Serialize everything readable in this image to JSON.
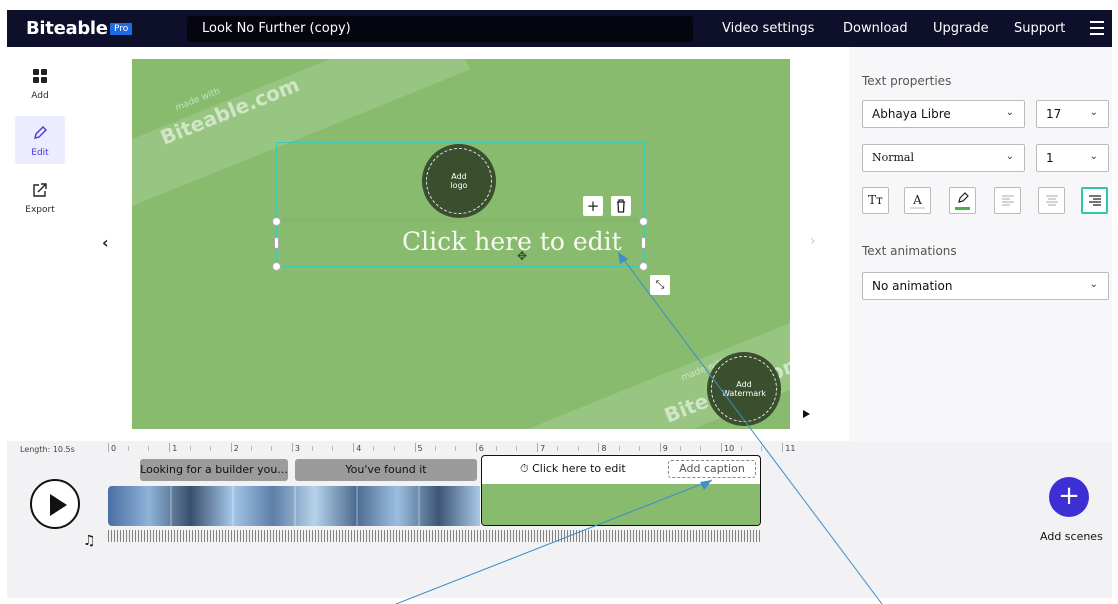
{
  "header": {
    "brand": "Biteable",
    "pro_badge": "Pro",
    "project_title": "Look No Further (copy)",
    "nav": [
      "Video settings",
      "Download",
      "Upgrade",
      "Support"
    ],
    "menu_icon": "hamburger-icon"
  },
  "rail": [
    {
      "label": "Add",
      "icon": "grid-icon"
    },
    {
      "label": "Edit",
      "icon": "pencil-icon",
      "active": true
    },
    {
      "label": "Export",
      "icon": "export-icon"
    }
  ],
  "canvas": {
    "background": "#88bb6e",
    "watermark_top_small": "made with",
    "watermark_top": "Biteable.com",
    "watermark_bottom_small": "made with",
    "watermark_bottom": "Biteable.com",
    "logo_badge": "Add\nlogo",
    "watermark_badge": "Add\nWatermark",
    "text": "Click here to edit",
    "prev_icon": "chevron-left-icon",
    "next_icon": "chevron-right-icon"
  },
  "panel": {
    "text_properties_title": "Text properties",
    "font_family": "Abhaya Libre",
    "font_size": "17",
    "font_style": "Normal",
    "line_height": "1",
    "format_icons": [
      "text-case-icon",
      "text-color-icon",
      "highlight-icon",
      "align-left-icon",
      "align-center-icon",
      "align-right-icon"
    ],
    "animations_title": "Text animations",
    "animation": "No animation",
    "highlight_color": "#4caf50",
    "accent_color": "#2fc6b0"
  },
  "timeline": {
    "length": "Length: 10.5s",
    "ticks": [
      "0",
      "1",
      "2",
      "3",
      "4",
      "5",
      "6",
      "7",
      "8",
      "9",
      "10",
      "11"
    ],
    "clips": [
      "Looking for a builder you...",
      "You've found it"
    ],
    "active_clip_caption": "Click here to edit",
    "add_caption": "Add caption",
    "add_scenes": "Add scenes"
  }
}
